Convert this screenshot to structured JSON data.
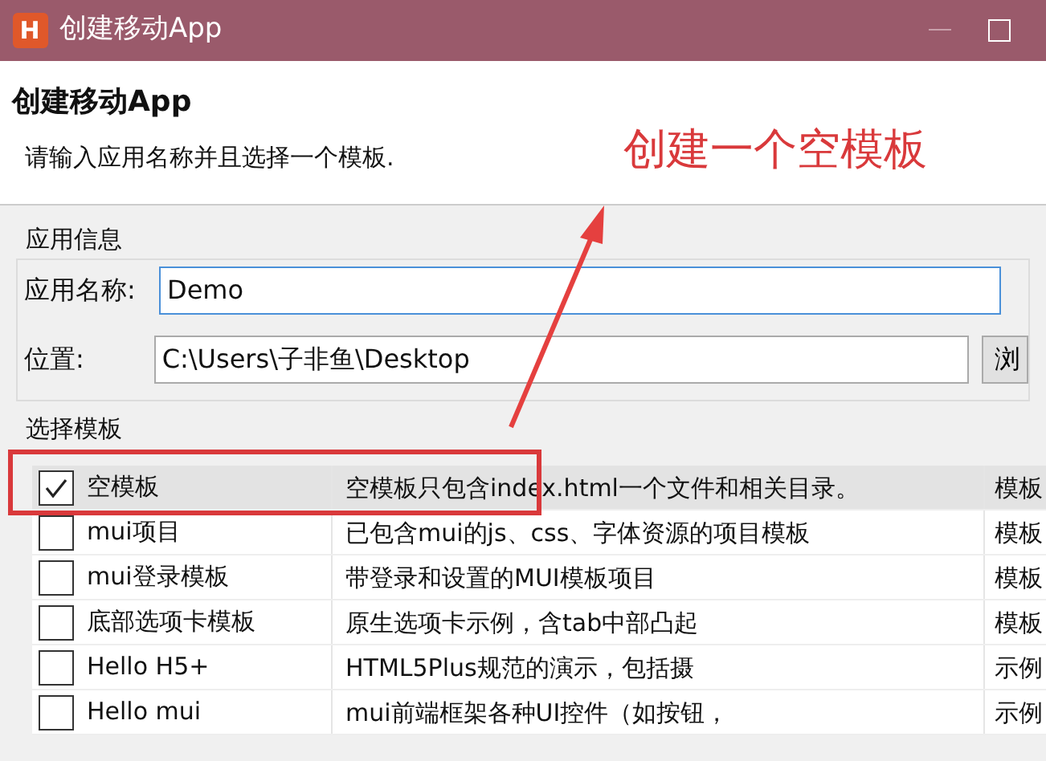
{
  "window": {
    "title": "创建移动App",
    "logo_text": "H"
  },
  "header": {
    "title": "创建移动App",
    "subtitle": "请输入应用名称并且选择一个模板."
  },
  "app_info": {
    "legend": "应用信息",
    "name_label": "应用名称:",
    "name_value": "Demo",
    "location_label": "位置:",
    "location_value": "C:\\Users\\子非鱼\\Desktop",
    "browse_button": "浏"
  },
  "templates": {
    "legend": "选择模板",
    "rows": [
      {
        "name": "空模板",
        "description": "空模板只包含index.html一个文件和相关目录。",
        "column_3": "模板",
        "checked": true,
        "selected": true
      },
      {
        "name": "mui项目",
        "description": "已包含mui的js、css、字体资源的项目模板",
        "column_3": "模板",
        "checked": false,
        "selected": false
      },
      {
        "name": "mui登录模板",
        "description": "带登录和设置的MUI模板项目",
        "column_3": "模板",
        "checked": false,
        "selected": false
      },
      {
        "name": "底部选项卡模板",
        "description": "原生选项卡示例，含tab中部凸起",
        "column_3": "模板",
        "checked": false,
        "selected": false
      },
      {
        "name": "Hello H5+",
        "description": "HTML5Plus规范的演示，包括摄",
        "column_3": "示例",
        "checked": false,
        "selected": false
      },
      {
        "name": "Hello mui",
        "description": "mui前端框架各种UI控件（如按钮，",
        "column_3": "示例",
        "checked": false,
        "selected": false
      }
    ]
  },
  "annotation": {
    "text": "创建一个空模板"
  }
}
